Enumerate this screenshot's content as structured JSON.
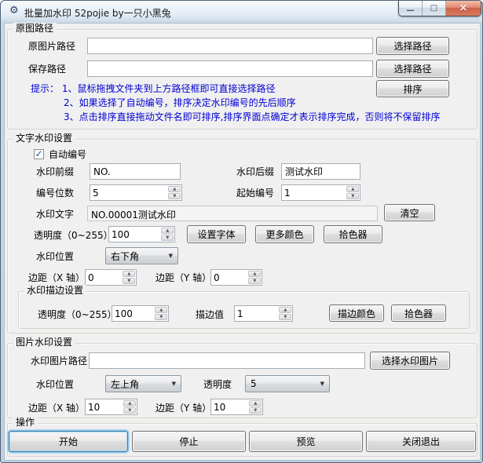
{
  "window": {
    "title": "批量加水印 52pojie by一只小黑兔"
  },
  "icons": {
    "app": "⚙",
    "minimize": "—",
    "maximize": "□",
    "close": "×",
    "dropdown": "▼",
    "spin_up": "▲",
    "spin_down": "▼",
    "check": "✓"
  },
  "colors": {
    "hint_text": "#0000d4",
    "close_button": "#ce6146",
    "focus_ring": "#69b5e6",
    "dialog_bg": "#f0f0f0"
  },
  "source_group": {
    "title": "原图路径",
    "src_label": "原图片路径",
    "src_value": "",
    "src_placeholder": "",
    "save_label": "保存路径",
    "save_value": "",
    "save_placeholder": "",
    "choose_path_label": "选择路径",
    "sort_label": "排序",
    "hint_line1": "提示：  1、鼠标拖拽文件夹到上方路径框即可直接选择路径",
    "hint_line2": "2、如果选择了自动编号，排序决定水印编号的先后顺序",
    "hint_line3": "3、点击排序直接拖动文件名即可排序,排序界面点确定才表示排序完成，否则将不保留排序"
  },
  "text_wm_group": {
    "title": "文字水印设置",
    "auto_number_label": "自动编号",
    "auto_number_checked": true,
    "prefix_label": "水印前缀",
    "prefix_value": "NO.",
    "suffix_label": "水印后缀",
    "suffix_value": "测试水印",
    "digits_label": "编号位数",
    "digits_value": "5",
    "start_label": "起始编号",
    "start_value": "1",
    "text_label": "水印文字",
    "text_value": "NO.00001测试水印",
    "clear_button": "清空",
    "opacity_label": "透明度（0~255）",
    "opacity_value": "100",
    "font_button": "设置字体",
    "more_colors_button": "更多颜色",
    "picker_button": "拾色器",
    "position_label": "水印位置",
    "position_value": "右下角",
    "margin_x_label": "边距（X 轴）",
    "margin_x_value": "0",
    "margin_y_label": "边距（Y 轴）",
    "margin_y_value": "0",
    "stroke": {
      "title": "水印描边设置",
      "opacity_label": "透明度（0~255）",
      "opacity_value": "100",
      "width_label": "描边值",
      "width_value": "1",
      "color_button": "描边颜色",
      "picker_button": "拾色器"
    }
  },
  "image_wm_group": {
    "title": "图片水印设置",
    "path_label": "水印图片路径",
    "path_value": "",
    "path_placeholder": "",
    "choose_button": "选择水印图片",
    "position_label": "水印位置",
    "position_value": "左上角",
    "opacity_label": "透明度",
    "opacity_value": "5",
    "margin_x_label": "边距（X 轴）",
    "margin_x_value": "10",
    "margin_y_label": "边距（Y 轴）",
    "margin_y_value": "10"
  },
  "action_group": {
    "title": "操作",
    "start_button": "开始",
    "stop_button": "停止",
    "preview_button": "预览",
    "exit_button": "关闭退出"
  }
}
